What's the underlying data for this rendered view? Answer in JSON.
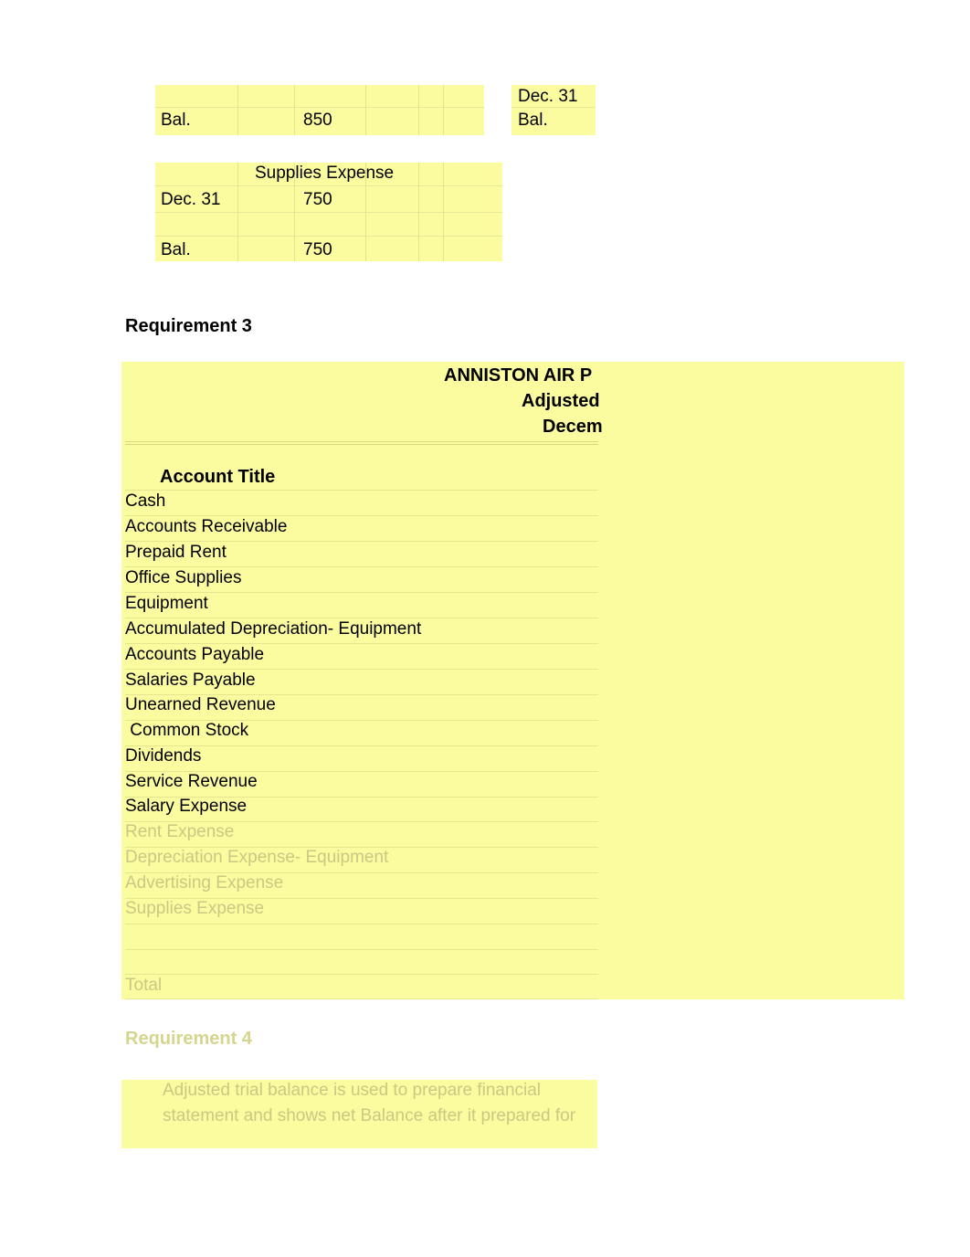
{
  "document": {
    "title": "Accounting worksheet - adjusted trial balance"
  },
  "taccount_top": {
    "rows": [
      {
        "label": "",
        "value": ""
      },
      {
        "label": "Bal.",
        "value": "850"
      }
    ],
    "right": {
      "date": "Dec. 31",
      "label": "Bal."
    }
  },
  "supplies_expense": {
    "header": "Supplies Expense",
    "rows": [
      {
        "label": "Dec. 31",
        "value": "750"
      },
      {
        "label": "Bal.",
        "value": "750"
      }
    ]
  },
  "requirement3": {
    "heading": "Requirement 3",
    "company": "ANNISTON AIR P",
    "statement": "Adjusted",
    "date": "Decem",
    "column_header": "Account Title",
    "accounts": [
      "Cash",
      "Accounts Receivable",
      "Prepaid Rent",
      "Office Supplies",
      "Equipment",
      "Accumulated Depreciation- Equipment",
      "Accounts Payable",
      "Salaries Payable",
      "Unearned Revenue",
      " Common Stock",
      "Dividends",
      "Service Revenue",
      "Salary Expense",
      "Rent Expense",
      "Depreciation Expense- Equipment",
      "Advertising Expense",
      "Supplies Expense"
    ],
    "total_label": "Total"
  },
  "requirement4": {
    "heading": "Requirement 4",
    "lines": [
      "Adjusted trial balance is used to prepare financial",
      "statement and shows net Balance after it prepared for"
    ]
  }
}
